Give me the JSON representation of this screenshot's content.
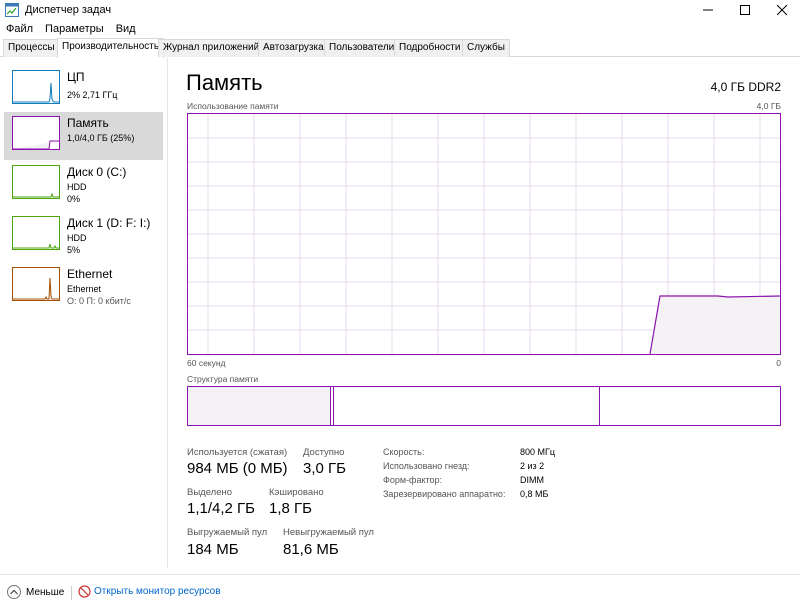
{
  "window": {
    "title": "Диспетчер задач",
    "controls": {
      "minimize": "minimize-icon",
      "maximize": "maximize-icon",
      "close": "close-icon"
    }
  },
  "menu": [
    "Файл",
    "Параметры",
    "Вид"
  ],
  "tabs": [
    {
      "label": "Процессы",
      "active": false
    },
    {
      "label": "Производительность",
      "active": true
    },
    {
      "label": "Журнал приложений",
      "active": false
    },
    {
      "label": "Автозагрузка",
      "active": false
    },
    {
      "label": "Пользователи",
      "active": false
    },
    {
      "label": "Подробности",
      "active": false
    },
    {
      "label": "Службы",
      "active": false
    }
  ],
  "sidebar": [
    {
      "title": "ЦП",
      "sub1": "2% 2,71 ГГц",
      "color": "#117dbb"
    },
    {
      "title": "Память",
      "sub1": "1,0/4,0 ГБ (25%)",
      "color": "#8b12ae",
      "selected": true
    },
    {
      "title": "Диск 0 (C:)",
      "sub1": "HDD",
      "sub2": "0%",
      "color": "#4da60c"
    },
    {
      "title": "Диск 1 (D: F: I:)",
      "sub1": "HDD",
      "sub2": "5%",
      "color": "#4da60c"
    },
    {
      "title": "Ethernet",
      "sub1": "Ethernet",
      "sub2": "О: 0 П: 0 кбит/с",
      "color": "#a74f01"
    }
  ],
  "main": {
    "title": "Память",
    "memory_type": "4,0 ГБ DDR2",
    "usage_label": "Использование памяти",
    "usage_max": "4,0 ГБ",
    "time_left": "60 секунд",
    "time_right": "0",
    "structure_label": "Структура памяти",
    "stats": {
      "in_use_label": "Используется (сжатая)",
      "in_use_value": "984 МБ (0 МБ)",
      "available_label": "Доступно",
      "available_value": "3,0 ГБ",
      "committed_label": "Выделено",
      "committed_value": "1,1/4,2 ГБ",
      "cached_label": "Кэшировано",
      "cached_value": "1,8 ГБ",
      "paged_label": "Выгружаемый пул",
      "paged_value": "184 МБ",
      "nonpaged_label": "Невыгружаемый пул",
      "nonpaged_value": "81,6 МБ"
    },
    "details": [
      {
        "key": "Скорость:",
        "value": "800 МГц"
      },
      {
        "key": "Использовано гнезд:",
        "value": "2 из 2"
      },
      {
        "key": "Форм-фактор:",
        "value": "DIMM"
      },
      {
        "key": "Зарезервировано аппаратно:",
        "value": "0,8 МБ"
      }
    ]
  },
  "footer": {
    "less": "Меньше",
    "monitor": "Открыть монитор ресурсов"
  },
  "colors": {
    "memory": "#8b12ae",
    "memory_fill": "#f4f2f4",
    "grid": "#e6d8ec"
  }
}
